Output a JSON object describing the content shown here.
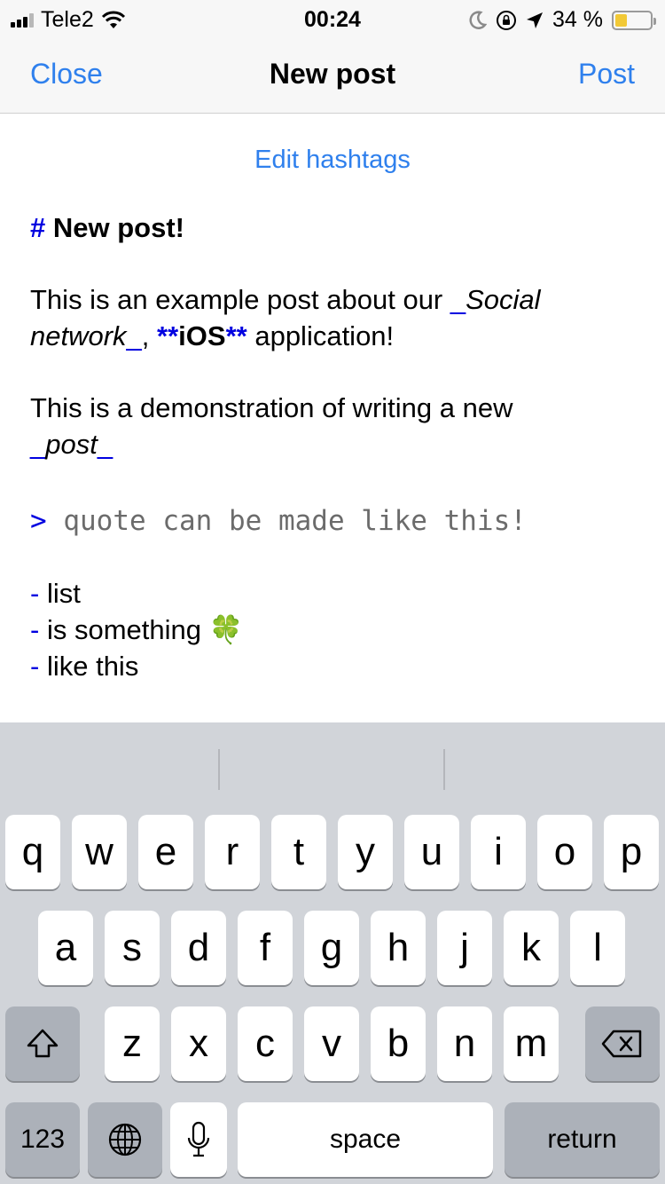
{
  "status_bar": {
    "carrier": "Tele2",
    "time": "00:24",
    "battery_percent": "34 %",
    "battery_level": 0.34
  },
  "nav": {
    "close_label": "Close",
    "title": "New post",
    "post_label": "Post"
  },
  "edit_hashtags": "Edit hashtags",
  "post": {
    "heading_marker": "#",
    "heading_text": "New post!",
    "p1_a": "This is an example post about our ",
    "p1_italic_open": "_",
    "p1_italic_1": "Social",
    "p1_italic_2": "network",
    "p1_italic_close": "_",
    "p1_comma": ", ",
    "p1_bold_open": "**",
    "p1_bold": "iOS",
    "p1_bold_close": "**",
    "p1_end": " application!",
    "p2_a": "This is a demonstration of writing a new",
    "p2_italic_open": "_",
    "p2_italic": "post",
    "p2_italic_close": "_",
    "quote_marker": ">",
    "quote_text": "quote can be made like this!",
    "list_marker": "-",
    "list_items": [
      "list",
      "is something 🍀",
      "like this"
    ]
  },
  "keyboard": {
    "row1": [
      "q",
      "w",
      "e",
      "r",
      "t",
      "y",
      "u",
      "i",
      "o",
      "p"
    ],
    "row2": [
      "a",
      "s",
      "d",
      "f",
      "g",
      "h",
      "j",
      "k",
      "l"
    ],
    "row3": [
      "z",
      "x",
      "c",
      "v",
      "b",
      "n",
      "m"
    ],
    "numbers_label": "123",
    "space_label": "space",
    "return_label": "return",
    "shift_icon": "shift-icon",
    "delete_icon": "backspace-icon",
    "globe_icon": "globe-icon",
    "mic_icon": "microphone-icon"
  },
  "colors": {
    "accent": "#2f80ed",
    "markdown_marker": "#0000e0",
    "keyboard_bg": "#d1d4d9",
    "battery_fill": "#f2c936"
  }
}
